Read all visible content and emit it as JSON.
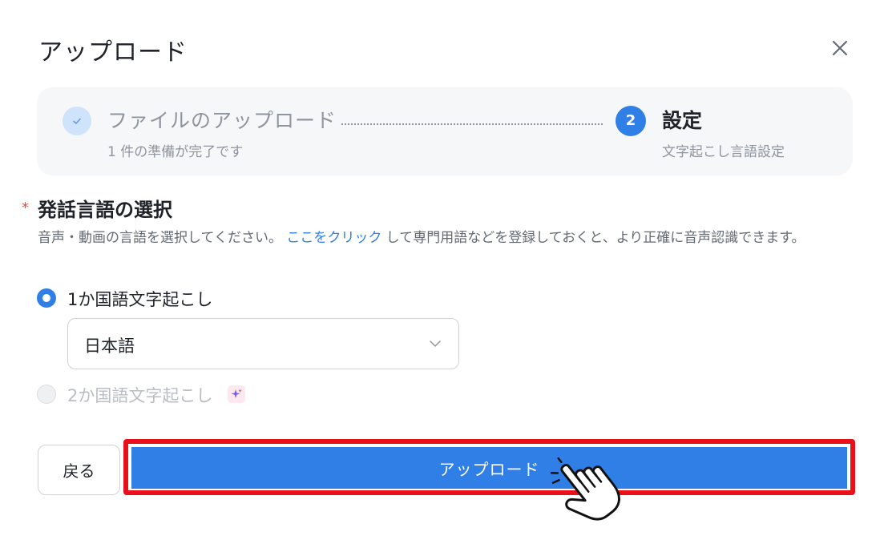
{
  "dialog": {
    "title": "アップロード"
  },
  "steps": {
    "step1": {
      "title": "ファイルのアップロード",
      "subtitle": "1 件の準備が完了です",
      "status": "done"
    },
    "step2": {
      "number": "2",
      "title": "設定",
      "subtitle": "文字起こし言語設定",
      "status": "active"
    }
  },
  "language_section": {
    "required_mark": "*",
    "title": "発話言語の選択",
    "description_before": "音声・動画の言語を選択してください。",
    "description_link": "ここをクリック",
    "description_after": "して専門用語などを登録しておくと、より正確に音声認識できます。",
    "options": [
      {
        "label": "1か国語文字起こし",
        "selected": true
      },
      {
        "label": "2か国語文字起こし",
        "selected": false,
        "disabled": true,
        "badge_icon": "ai-sparkle-icon"
      }
    ],
    "language_select": {
      "value": "日本語"
    }
  },
  "footer": {
    "back_label": "戻る",
    "upload_label": "アップロード"
  },
  "colors": {
    "accent": "#2f7fe6",
    "highlight": "#e8101a",
    "required": "#e34d4d"
  }
}
